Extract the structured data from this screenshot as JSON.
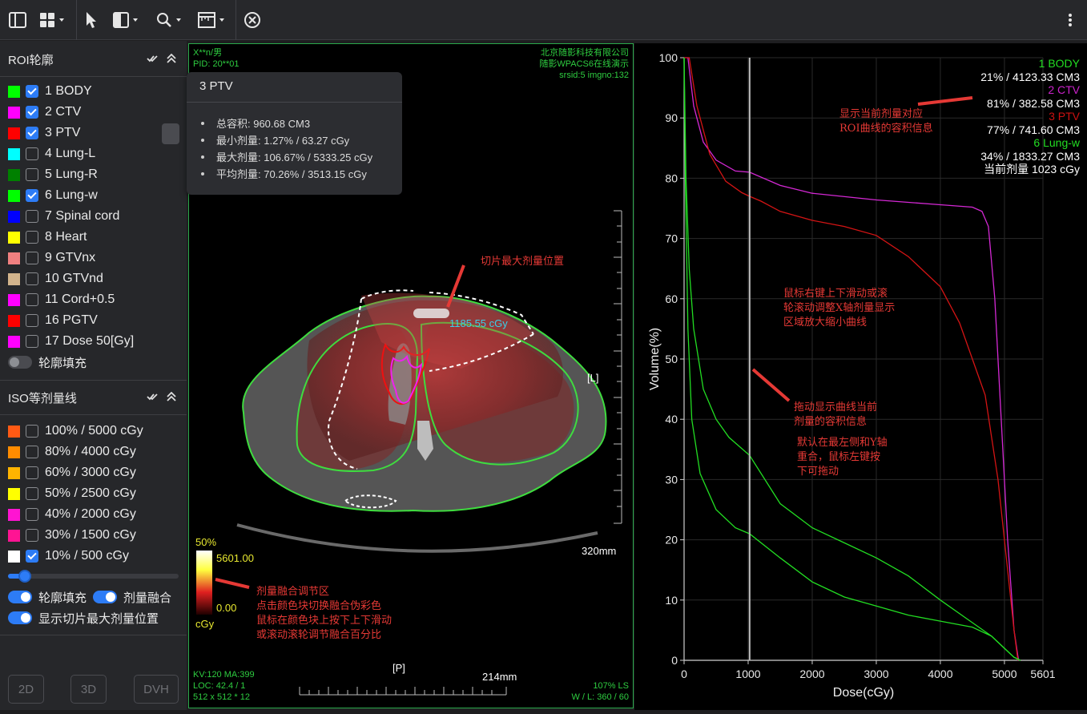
{
  "toolbar": {
    "icons": [
      "sidebar-icon",
      "layout-grid-icon",
      "pointer-icon",
      "window-level-icon",
      "zoom-icon",
      "ruler-icon",
      "close-icon",
      "more-icon"
    ]
  },
  "roi": {
    "title": "ROI轮廓",
    "items": [
      {
        "label": "1 BODY",
        "color": "#00ff00",
        "checked": true
      },
      {
        "label": "2 CTV",
        "color": "#ff00ff",
        "checked": true
      },
      {
        "label": "3 PTV",
        "color": "#ff0000",
        "checked": true
      },
      {
        "label": "4 Lung-L",
        "color": "#00ffff",
        "checked": false
      },
      {
        "label": "5 Lung-R",
        "color": "#008000",
        "checked": false
      },
      {
        "label": "6 Lung-w",
        "color": "#00ff00",
        "checked": true
      },
      {
        "label": "7 Spinal cord",
        "color": "#0000ff",
        "checked": false
      },
      {
        "label": "8 Heart",
        "color": "#ffff00",
        "checked": false
      },
      {
        "label": "9 GTVnx",
        "color": "#f08080",
        "checked": false
      },
      {
        "label": "10 GTVnd",
        "color": "#d2b48c",
        "checked": false
      },
      {
        "label": "11 Cord+0.5",
        "color": "#ff00ff",
        "checked": false
      },
      {
        "label": "16 PGTV",
        "color": "#ff0000",
        "checked": false
      },
      {
        "label": "17 Dose 50[Gy]",
        "color": "#ff00ff",
        "checked": false
      }
    ],
    "fill_toggle_label": "轮廓填充"
  },
  "iso": {
    "title": "ISO等剂量线",
    "items": [
      {
        "label": "100% / 5000 cGy",
        "color": "#ff5a14",
        "checked": false
      },
      {
        "label": "80% / 4000 cGy",
        "color": "#ff8c00",
        "checked": false
      },
      {
        "label": "60% / 3000 cGy",
        "color": "#ffb400",
        "checked": false
      },
      {
        "label": "50% / 2500 cGy",
        "color": "#ffff00",
        "checked": false
      },
      {
        "label": "40% / 2000 cGy",
        "color": "#ff14d2",
        "checked": false
      },
      {
        "label": "30% / 1500 cGy",
        "color": "#ff1493",
        "checked": false
      },
      {
        "label": "10% / 500 cGy",
        "color": "#ffffff",
        "checked": true
      }
    ],
    "slider_value": 0.1,
    "toggle_fill_label": "轮廓填充",
    "toggle_blend_label": "剂量融合",
    "toggle_maxdose_label": "显示切片最大剂量位置"
  },
  "buttons": {
    "b2d": "2D",
    "b3d": "3D",
    "bdvh": "DVH"
  },
  "tooltip": {
    "title": "3 PTV",
    "lines": [
      "总容积: 960.68 CM3",
      "最小剂量: 1.27% / 63.27 cGy",
      "最大剂量: 106.67% / 5333.25 cGy",
      "平均剂量: 70.26% / 3513.15 cGy"
    ]
  },
  "viewer": {
    "patient": "X**n/男",
    "pid": "PID: 20**01",
    "org": "北京随影科技有限公司",
    "product": "随影WPACS6在线演示",
    "series": "srsid:5 imgno:132",
    "label_L": "[L]",
    "label_P": "[P]",
    "scale_v": "320mm",
    "scale_h": "214mm",
    "max_dose": "1185.55 cGy",
    "kv": "KV:120 MA:399",
    "loc": "LOC: 42.4 / 1",
    "matrix": "512 x 512 * 12",
    "zoom": "107% LS",
    "wl": "W / L:  360 / 60",
    "legend_pct": "50%",
    "legend_max": "5601.00",
    "legend_min": "0.00",
    "legend_unit": "cGy"
  },
  "annotations": {
    "max_dose_pos": "切片最大剂量位置",
    "blend": [
      "剂量融合调节区",
      "点击颜色块切换融合伪彩色",
      "鼠标在颜色块上按下上下滑动",
      "或滚动滚轮调节融合百分比"
    ],
    "volume_info": [
      "显示当前剂量对应",
      "ROI曲线的容积信息"
    ],
    "zoom_curve": [
      "鼠标右键上下滑动或滚",
      "轮滚动调整X轴剂量显示",
      "区域放大缩小曲线"
    ],
    "drag_curve": [
      "拖动显示曲线当前",
      "剂量的容积信息"
    ],
    "default_pos": [
      "默认在最左侧和Y轴",
      "重合，鼠标左键按",
      "下可拖动"
    ]
  },
  "chart_data": {
    "type": "line",
    "xlabel": "Dose(cGy)",
    "ylabel": "Volume(%)",
    "xlim": [
      0,
      5601
    ],
    "ylim": [
      0,
      100
    ],
    "x_ticks": [
      0,
      1000,
      2000,
      3000,
      4000,
      5000,
      5601
    ],
    "y_ticks": [
      0,
      10,
      20,
      30,
      40,
      50,
      60,
      70,
      80,
      90,
      100
    ],
    "grid": true,
    "cursor_dose": 1023,
    "legend_position": "top-right",
    "legend": [
      {
        "name": "1 BODY",
        "info": "21% / 4123.33 CM3",
        "color": "#22dd22"
      },
      {
        "name": "2 CTV",
        "info": "81% / 382.58 CM3",
        "color": "#cc22cc"
      },
      {
        "name": "3 PTV",
        "info": "77% / 741.60 CM3",
        "color": "#cc1111"
      },
      {
        "name": "6 Lung-w",
        "info": "34% / 1833.27 CM3",
        "color": "#22dd22"
      }
    ],
    "current_dose_label": "当前剂量 1023 cGy",
    "series": [
      {
        "name": "2 CTV",
        "color": "#d428d4",
        "points": [
          [
            0,
            100
          ],
          [
            60,
            100
          ],
          [
            150,
            92
          ],
          [
            300,
            86
          ],
          [
            500,
            83
          ],
          [
            800,
            81.2
          ],
          [
            1023,
            81
          ],
          [
            1500,
            78.8
          ],
          [
            2000,
            77.5
          ],
          [
            3000,
            76.4
          ],
          [
            4000,
            75.6
          ],
          [
            4500,
            75.2
          ],
          [
            4650,
            74.5
          ],
          [
            4750,
            72
          ],
          [
            4850,
            60
          ],
          [
            4950,
            40
          ],
          [
            5050,
            20
          ],
          [
            5150,
            5
          ],
          [
            5220,
            0
          ]
        ]
      },
      {
        "name": "3 PTV",
        "color": "#d41414",
        "points": [
          [
            0,
            100
          ],
          [
            80,
            100
          ],
          [
            200,
            92
          ],
          [
            400,
            84
          ],
          [
            650,
            79.5
          ],
          [
            900,
            77.6
          ],
          [
            1023,
            77
          ],
          [
            1200,
            76.2
          ],
          [
            1500,
            74.5
          ],
          [
            2000,
            73
          ],
          [
            2500,
            72
          ],
          [
            3000,
            70.5
          ],
          [
            3500,
            67
          ],
          [
            4000,
            62
          ],
          [
            4300,
            56
          ],
          [
            4500,
            50
          ],
          [
            4700,
            44
          ],
          [
            4900,
            30
          ],
          [
            5050,
            15
          ],
          [
            5150,
            5
          ],
          [
            5210,
            0
          ]
        ]
      },
      {
        "name": "6 Lung-w",
        "color": "#22dd22",
        "points": [
          [
            0,
            100
          ],
          [
            30,
            80
          ],
          [
            80,
            65
          ],
          [
            150,
            55
          ],
          [
            300,
            45
          ],
          [
            500,
            40
          ],
          [
            700,
            37
          ],
          [
            1023,
            34
          ],
          [
            1500,
            26
          ],
          [
            2000,
            22
          ],
          [
            2500,
            19.5
          ],
          [
            3000,
            17
          ],
          [
            3500,
            14
          ],
          [
            4000,
            10
          ],
          [
            4400,
            7
          ],
          [
            4800,
            4
          ],
          [
            5000,
            2
          ],
          [
            5150,
            0.5
          ],
          [
            5250,
            0
          ]
        ]
      },
      {
        "name": "1 BODY",
        "color": "#22dd22",
        "points": [
          [
            0,
            100
          ],
          [
            20,
            80
          ],
          [
            60,
            55
          ],
          [
            120,
            40
          ],
          [
            250,
            31
          ],
          [
            500,
            25
          ],
          [
            800,
            22
          ],
          [
            1023,
            21
          ],
          [
            1500,
            17
          ],
          [
            2000,
            13
          ],
          [
            2500,
            10.5
          ],
          [
            3000,
            9
          ],
          [
            3500,
            7.5
          ],
          [
            4000,
            6.5
          ],
          [
            4500,
            5.5
          ],
          [
            4800,
            4
          ],
          [
            5000,
            2
          ],
          [
            5150,
            0.5
          ],
          [
            5250,
            0
          ]
        ]
      }
    ]
  }
}
